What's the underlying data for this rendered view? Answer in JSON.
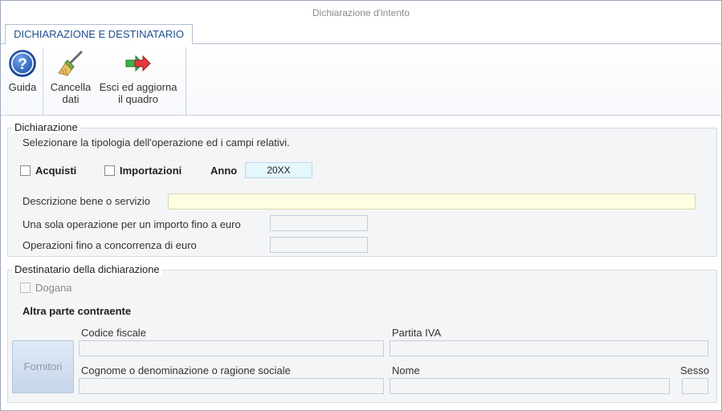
{
  "window": {
    "title": "Dichiarazione d'intento"
  },
  "tabs": [
    {
      "label": "DICHIARAZIONE E DESTINATARIO"
    }
  ],
  "toolbar": {
    "guida": {
      "label": "Guida",
      "icon": "help-icon"
    },
    "cancella": {
      "line1": "Cancella",
      "line2": "dati",
      "icon": "broom-icon"
    },
    "esci": {
      "line1": "Esci ed aggiorna",
      "line2": "il quadro",
      "icon": "exit-arrow-icon"
    }
  },
  "dichiarazione": {
    "legend": "Dichiarazione",
    "instruction": "Selezionare la tipologia dell'operazione ed i campi relativi.",
    "acquisti_label": "Acquisti",
    "importazioni_label": "Importazioni",
    "anno_label": "Anno",
    "anno_value": "20XX",
    "descrizione_label": "Descrizione bene o servizio",
    "descrizione_value": "",
    "una_sola_label": "Una sola operazione per un importo fino a euro",
    "una_sola_value": "",
    "concorrenza_label": "Operazioni fino a concorrenza di euro",
    "concorrenza_value": ""
  },
  "destinatario": {
    "legend": "Destinatario della dichiarazione",
    "dogana_label": "Dogana",
    "altra_parte_label": "Altra parte contraente",
    "fornitori_label": "Fornitori",
    "codice_fiscale_label": "Codice fiscale",
    "codice_fiscale_value": "",
    "partita_iva_label": "Partita IVA",
    "partita_iva_value": "",
    "cognome_label": "Cognome o denominazione o ragione sociale",
    "cognome_value": "",
    "nome_label": "Nome",
    "nome_value": "",
    "sesso_label": "Sesso",
    "sesso_value": ""
  },
  "colors": {
    "tab_text": "#1f4f8f",
    "accent_blue": "#2a63b8",
    "field_yellow": "#fefee3",
    "field_cyan": "#e4f7fd"
  }
}
